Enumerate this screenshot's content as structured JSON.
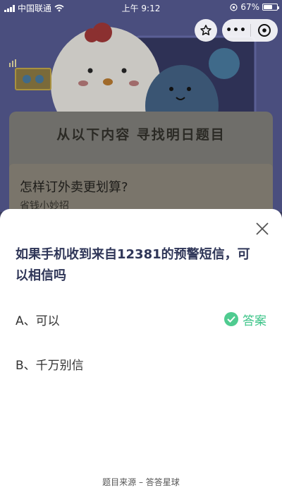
{
  "status_bar": {
    "carrier": "中国联通",
    "time": "上午 9:12",
    "battery_percent": "67%",
    "battery_level": 0.67
  },
  "top_bar": {
    "icons": [
      "star-icon",
      "more-icon",
      "close-circle-icon"
    ],
    "more_label": "•••"
  },
  "background": {
    "card_title": "从以下内容  寻找明日题目",
    "sub_question": "怎样订外卖更划算?",
    "sub_author": "省钱小妙招"
  },
  "sheet": {
    "question": "如果手机收到来自12381的预警短信，可以相信吗",
    "options": [
      {
        "label": "A、可以",
        "is_answer": true
      },
      {
        "label": "B、千万别信",
        "is_answer": false
      }
    ],
    "answer_label": "答案",
    "source": "题目来源 – 答答星球",
    "colors": {
      "accent": "#3fc58a",
      "question": "#2f3658"
    }
  }
}
